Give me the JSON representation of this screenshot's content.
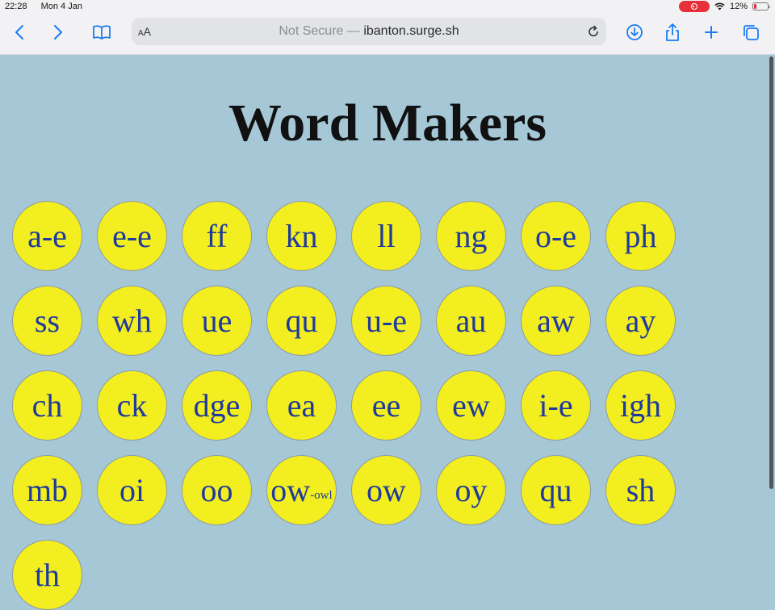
{
  "status": {
    "time": "22:28",
    "date": "Mon 4 Jan",
    "battery": "12%"
  },
  "browser": {
    "aa_label_small": "A",
    "aa_label": "A",
    "url_prefix": "Not Secure — ",
    "url_host": "ibanton.surge.sh"
  },
  "page": {
    "title": "Word Makers",
    "tiles": [
      {
        "text": "a-e"
      },
      {
        "text": "e-e"
      },
      {
        "text": "ff"
      },
      {
        "text": "kn"
      },
      {
        "text": "ll"
      },
      {
        "text": "ng"
      },
      {
        "text": "o-e"
      },
      {
        "text": "ph"
      },
      {
        "text": "ss"
      },
      {
        "text": "wh"
      },
      {
        "text": "ue"
      },
      {
        "text": "qu"
      },
      {
        "text": "u-e"
      },
      {
        "text": "au"
      },
      {
        "text": "aw"
      },
      {
        "text": "ay"
      },
      {
        "text": "ch"
      },
      {
        "text": "ck"
      },
      {
        "text": "dge"
      },
      {
        "text": "ea"
      },
      {
        "text": "ee"
      },
      {
        "text": "ew"
      },
      {
        "text": "i-e"
      },
      {
        "text": "igh"
      },
      {
        "text": "mb"
      },
      {
        "text": "oi"
      },
      {
        "text": "oo"
      },
      {
        "text": "ow",
        "sub": "-owl"
      },
      {
        "text": "ow"
      },
      {
        "text": "oy"
      },
      {
        "text": "qu"
      },
      {
        "text": "sh"
      },
      {
        "text": "th"
      }
    ]
  }
}
